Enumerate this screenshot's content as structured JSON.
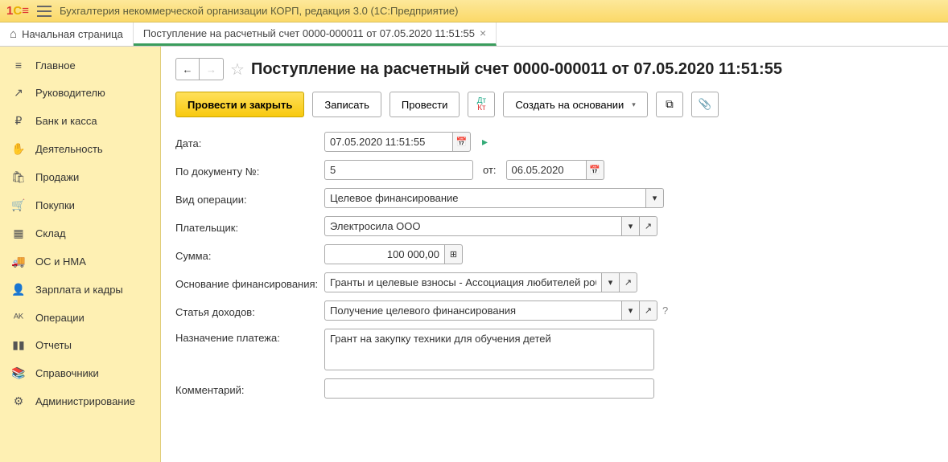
{
  "app": {
    "title": "Бухгалтерия некоммерческой организации КОРП, редакция 3.0  (1С:Предприятие)"
  },
  "tabs": {
    "home": "Начальная страница",
    "doc": "Поступление на расчетный счет 0000-000011 от 07.05.2020 11:51:55"
  },
  "sidebar": [
    {
      "icon": "≡",
      "label": "Главное"
    },
    {
      "icon": "↗",
      "label": "Руководителю"
    },
    {
      "icon": "₽",
      "label": "Банк и касса"
    },
    {
      "icon": "✋",
      "label": "Деятельность"
    },
    {
      "icon": "🛍",
      "label": "Продажи"
    },
    {
      "icon": "🛒",
      "label": "Покупки"
    },
    {
      "icon": "▦",
      "label": "Склад"
    },
    {
      "icon": "🚚",
      "label": "ОС и НМА"
    },
    {
      "icon": "👤",
      "label": "Зарплата и кадры"
    },
    {
      "icon": "ᴬᴷ",
      "label": "Операции"
    },
    {
      "icon": "▮▮",
      "label": "Отчеты"
    },
    {
      "icon": "📚",
      "label": "Справочники"
    },
    {
      "icon": "⚙",
      "label": "Администрирование"
    }
  ],
  "page": {
    "title": "Поступление на расчетный счет 0000-000011 от 07.05.2020 11:51:55",
    "back": "←",
    "fwd": "→"
  },
  "toolbar": {
    "post_close": "Провести и закрыть",
    "save": "Записать",
    "post": "Провести",
    "create_from": "Создать на основании"
  },
  "form": {
    "date_label": "Дата:",
    "date_value": "07.05.2020 11:51:55",
    "docnum_label": "По документу №:",
    "docnum_value": "5",
    "from_label": "от:",
    "from_value": "06.05.2020",
    "optype_label": "Вид операции:",
    "optype_value": "Целевое финансирование",
    "payer_label": "Плательщик:",
    "payer_value": "Электросила ООО",
    "sum_label": "Сумма:",
    "sum_value": "100 000,00",
    "basis_label": "Основание финансирования:",
    "basis_value": "Гранты и целевые взносы - Ассоциация любителей роботов",
    "income_label": "Статья доходов:",
    "income_value": "Получение целевого финансирования",
    "purpose_label": "Назначение платежа:",
    "purpose_value": "Грант на закупку техники для обучения детей",
    "comment_label": "Комментарий:",
    "comment_value": ""
  }
}
